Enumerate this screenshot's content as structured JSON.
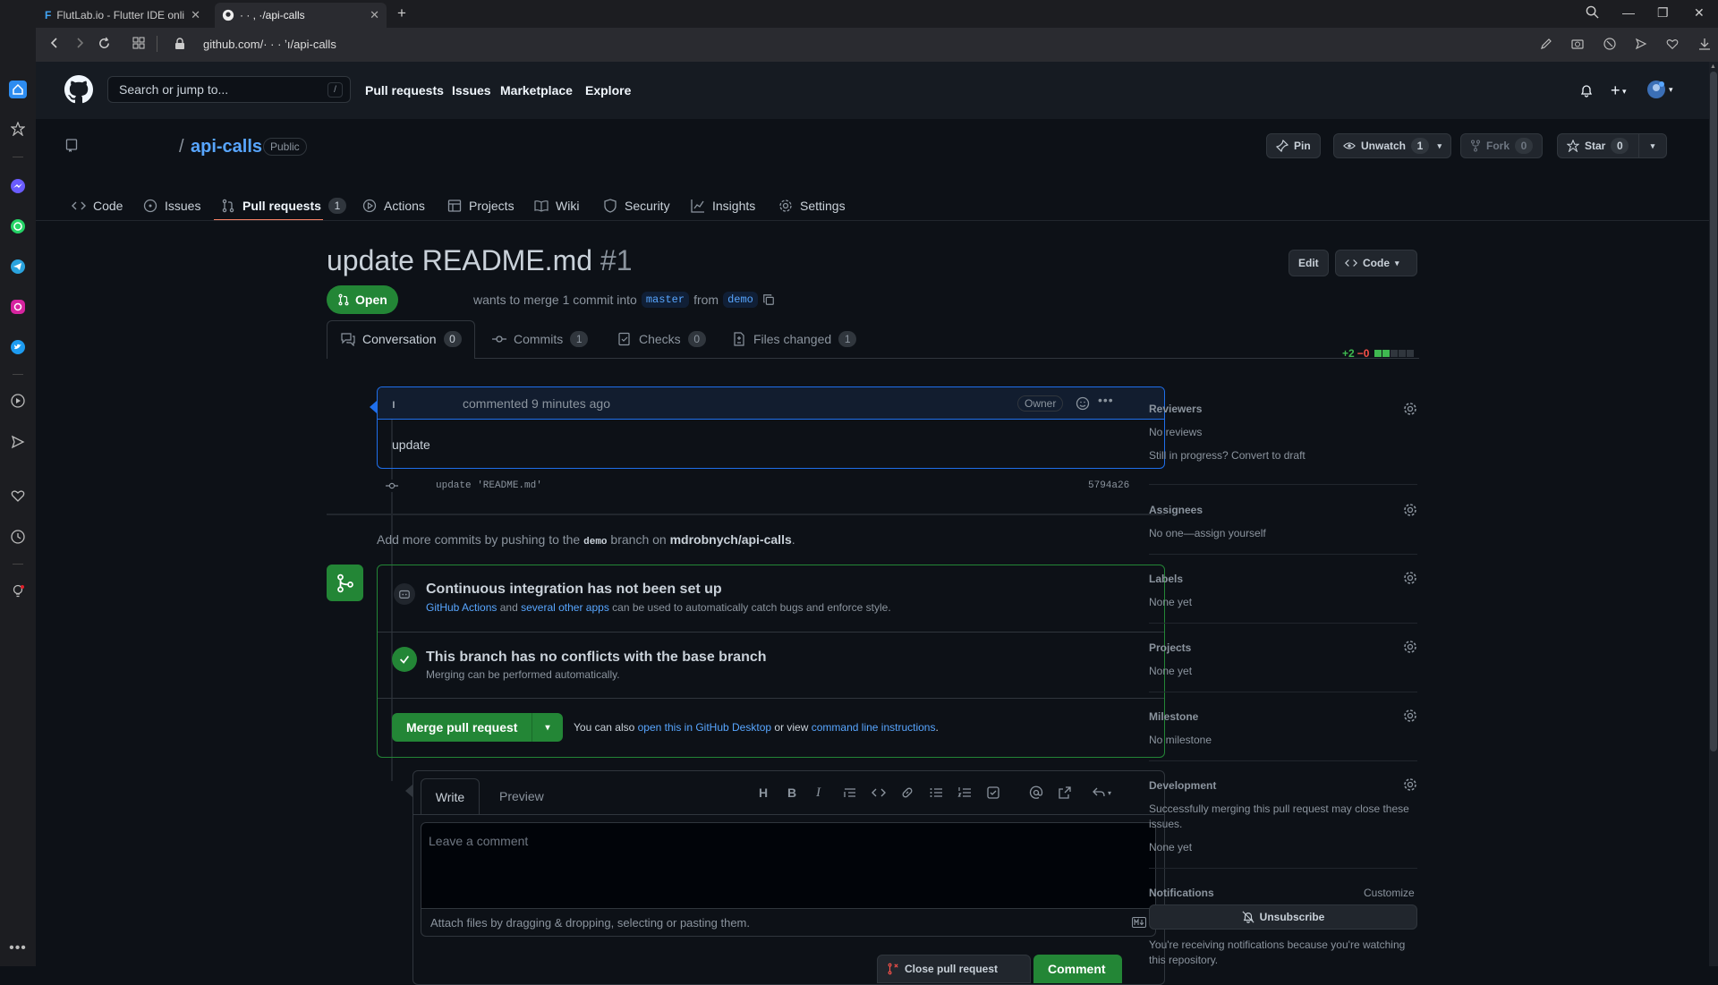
{
  "browser": {
    "tabs": [
      {
        "title": "FlutLab.io - Flutter IDE onli",
        "icon": "flutlab-icon"
      },
      {
        "title": "·  ·   ,  ·/api-calls",
        "icon": "github-icon"
      }
    ],
    "url": "github.com/·   ·   ·   ʼı/api-calls"
  },
  "header": {
    "search_placeholder": "Search or jump to...",
    "slash": "/",
    "nav": [
      "Pull requests",
      "Issues",
      "Marketplace",
      "Explore"
    ]
  },
  "repo": {
    "slash": "/",
    "name": "api-calls",
    "visibility": "Public",
    "pin_label": "Pin",
    "unwatch_label": "Unwatch",
    "unwatch_count": "1",
    "fork_label": "Fork",
    "fork_count": "0",
    "star_label": "Star",
    "star_count": "0",
    "tabs": [
      {
        "label": "Code",
        "icon": "code-icon"
      },
      {
        "label": "Issues",
        "icon": "issue-icon"
      },
      {
        "label": "Pull requests",
        "icon": "pull-request-icon",
        "count": "1"
      },
      {
        "label": "Actions",
        "icon": "play-icon"
      },
      {
        "label": "Projects",
        "icon": "table-icon"
      },
      {
        "label": "Wiki",
        "icon": "book-icon"
      },
      {
        "label": "Security",
        "icon": "shield-icon"
      },
      {
        "label": "Insights",
        "icon": "graph-icon"
      },
      {
        "label": "Settings",
        "icon": "gear-icon"
      }
    ]
  },
  "pr": {
    "title": "update README.md",
    "number": "#1",
    "edit_label": "Edit",
    "code_label": "Code",
    "status": "Open",
    "merge_text": "wants to merge 1 commit into",
    "base_branch": "master",
    "from_text": "from",
    "head_branch": "demo",
    "tabs": [
      {
        "label": "Conversation",
        "count": "0"
      },
      {
        "label": "Commits",
        "count": "1"
      },
      {
        "label": "Checks",
        "count": "0"
      },
      {
        "label": "Files changed",
        "count": "1"
      }
    ],
    "diff_add": "+2",
    "diff_del": "−0"
  },
  "comment": {
    "author": "ı",
    "meta": "commented 9 minutes ago",
    "role": "Owner",
    "body": "update"
  },
  "commit": {
    "message": "update 'README.md'",
    "sha": "5794a26"
  },
  "push_hint": {
    "before": "Add more commits by pushing to the",
    "branch": "demo",
    "middle": "branch on",
    "repo": "mdrobnych/api-calls",
    "after": "."
  },
  "merge_box": {
    "ci_title": "Continuous integration has not been set up",
    "ci_link1": "GitHub Actions",
    "ci_and": "and",
    "ci_link2": "several other apps",
    "ci_rest": "can be used to automatically catch bugs and enforce style.",
    "conflict_title": "This branch has no conflicts with the base branch",
    "conflict_sub": "Merging can be performed automatically.",
    "merge_button": "Merge pull request",
    "also": "You can also",
    "desktop_link": "open this in GitHub Desktop",
    "or_view": "or view",
    "cli_link": "command line instructions",
    "dot": "."
  },
  "editor": {
    "tab_write": "Write",
    "tab_preview": "Preview",
    "placeholder": "Leave a comment",
    "attach": "Attach files by dragging & dropping, selecting or pasting them.",
    "close_button": "Close pull request",
    "comment_button": "Comment"
  },
  "sidebar": {
    "reviewers": {
      "title": "Reviewers",
      "line1": "No reviews",
      "line2": "Still in progress? Convert to draft"
    },
    "assignees": {
      "title": "Assignees",
      "line1": "No one—assign yourself"
    },
    "labels": {
      "title": "Labels",
      "line1": "None yet"
    },
    "projects": {
      "title": "Projects",
      "line1": "None yet"
    },
    "milestone": {
      "title": "Milestone",
      "line1": "No milestone"
    },
    "development": {
      "title": "Development",
      "line1": "Successfully merging this pull request may close these issues.",
      "line2": "None yet"
    },
    "notifications": {
      "title": "Notifications",
      "customize": "Customize",
      "button": "Unsubscribe",
      "note": "You're receiving notifications because you're watching this repository."
    }
  },
  "colors": {
    "accent": "#58a6ff",
    "green": "#238636",
    "bg": "#0d1117",
    "header": "#161b22"
  }
}
